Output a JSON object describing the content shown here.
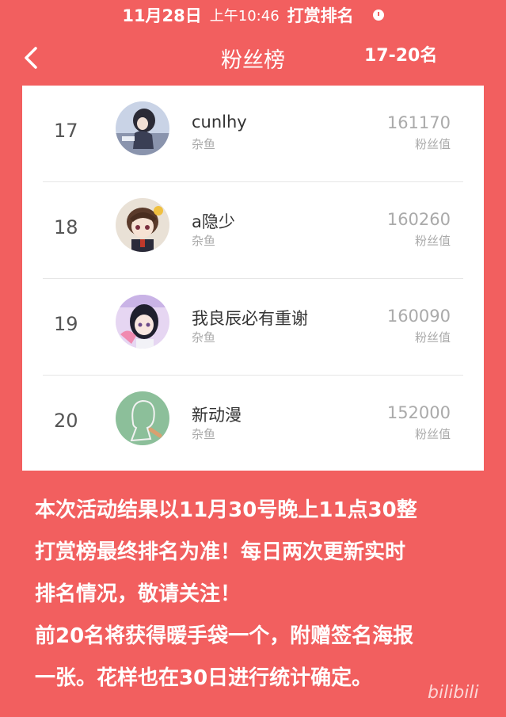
{
  "status_bar": {
    "date": "11月28日",
    "time": "上午10:46",
    "title": "打赏排名",
    "alarm_icon": "alarm-clock-icon"
  },
  "nav": {
    "back_icon": "chevron-left-icon",
    "title": "粉丝榜",
    "range": "17-20名"
  },
  "leaderboard": [
    {
      "rank": "17",
      "name": "cunlhy",
      "level": "杂鱼",
      "score": "161170",
      "score_label": "粉丝值"
    },
    {
      "rank": "18",
      "name": "a隐少",
      "level": "杂鱼",
      "score": "160260",
      "score_label": "粉丝值"
    },
    {
      "rank": "19",
      "name": "我良辰必有重谢",
      "level": "杂鱼",
      "score": "160090",
      "score_label": "粉丝值"
    },
    {
      "rank": "20",
      "name": "新动漫",
      "level": "杂鱼",
      "score": "152000",
      "score_label": "粉丝值"
    }
  ],
  "notice": {
    "line1": "本次活动结果以11月30号晚上11点30整",
    "line2": "打赏榜最终排名为准！每日两次更新实时",
    "line3": "排名情况，敬请关注！",
    "line4": "前20名将获得暖手袋一个，附赠签名海报",
    "line5": "一张。花样也在30日进行统计确定。"
  },
  "watermark": "bilibili",
  "colors": {
    "background": "#f25f5f",
    "card": "#ffffff"
  }
}
